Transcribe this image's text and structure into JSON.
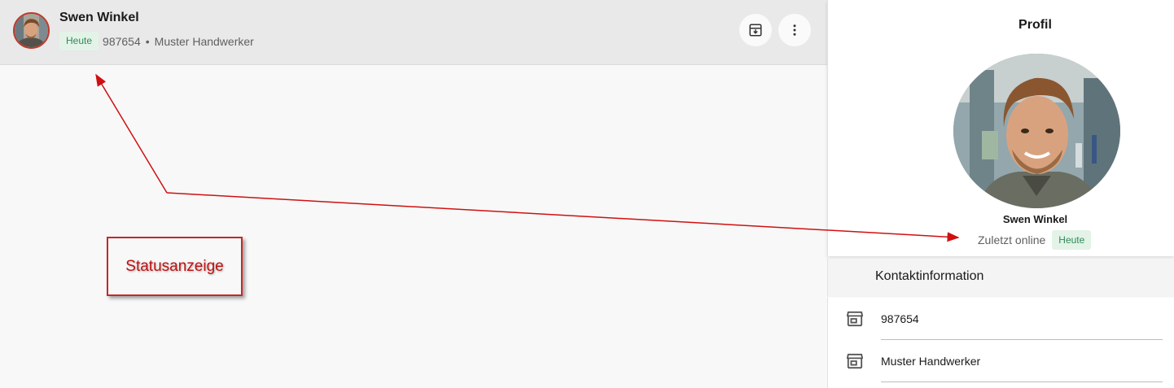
{
  "chat_header": {
    "contact_name": "Swen Winkel",
    "status_badge": "Heute",
    "customer_number": "987654",
    "separator": "•",
    "company": "Muster Handwerker",
    "archive_icon": "archive-download-icon",
    "more_icon": "more-vert-icon"
  },
  "annotation": {
    "label": "Statusanzeige",
    "color": "#c62828"
  },
  "profile": {
    "title": "Profil",
    "name": "Swen Winkel",
    "last_online_label": "Zuletzt online",
    "last_online_badge": "Heute"
  },
  "contact_info": {
    "title": "Kontaktinformation",
    "items": [
      {
        "icon": "store-icon",
        "value": "987654"
      },
      {
        "icon": "store-icon",
        "value": "Muster Handwerker"
      }
    ]
  },
  "colors": {
    "badge_bg": "#e3f3e7",
    "badge_text": "#2e8b57",
    "header_bg": "#e9e9e9",
    "annotation_red": "#c62828"
  }
}
